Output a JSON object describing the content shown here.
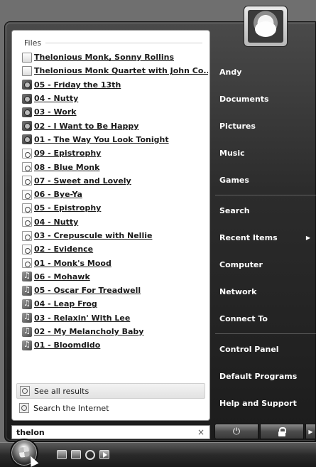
{
  "search": {
    "value": "thelon",
    "clear_glyph": "×"
  },
  "files": {
    "header": "Files",
    "items": [
      {
        "label": "Thelonious Monk, Sonny Rollins",
        "icon": "document-icon"
      },
      {
        "label": "Thelonious Monk Quartet with John Co...",
        "icon": "document-icon"
      },
      {
        "label": "05 - Friday the 13th",
        "icon": "album-art-icon"
      },
      {
        "label": "04 - Nutty",
        "icon": "album-art-icon"
      },
      {
        "label": "03 - Work",
        "icon": "album-art-icon"
      },
      {
        "label": "02 - I Want to Be Happy",
        "icon": "album-art-icon"
      },
      {
        "label": "01 - The Way You Look Tonight",
        "icon": "album-art-icon"
      },
      {
        "label": "09 - Epistrophy",
        "icon": "audio-file-icon"
      },
      {
        "label": "08 - Blue Monk",
        "icon": "audio-file-icon"
      },
      {
        "label": "07 - Sweet and Lovely",
        "icon": "audio-file-icon"
      },
      {
        "label": "06 - Bye-Ya",
        "icon": "audio-file-icon"
      },
      {
        "label": "05 - Epistrophy",
        "icon": "audio-file-icon"
      },
      {
        "label": "04 - Nutty",
        "icon": "audio-file-icon"
      },
      {
        "label": "03 - Crepuscule with Nellie",
        "icon": "audio-file-icon"
      },
      {
        "label": "02 - Evidence",
        "icon": "audio-file-icon"
      },
      {
        "label": "01 - Monk's Mood",
        "icon": "audio-file-icon"
      },
      {
        "label": "06 - Mohawk",
        "icon": "music-file-icon"
      },
      {
        "label": "05 - Oscar For Treadwell",
        "icon": "music-file-icon"
      },
      {
        "label": "04 - Leap Frog",
        "icon": "music-file-icon"
      },
      {
        "label": "03 - Relaxin' With Lee",
        "icon": "music-file-icon"
      },
      {
        "label": "02 - My Melancholy Baby",
        "icon": "music-file-icon"
      },
      {
        "label": "01 - Bloomdido",
        "icon": "music-file-icon"
      }
    ]
  },
  "bottom_links": {
    "see_all": "See all results",
    "search_internet": "Search the Internet"
  },
  "right_pane": {
    "user": "Andy",
    "documents": "Documents",
    "pictures": "Pictures",
    "music": "Music",
    "games": "Games",
    "search": "Search",
    "recent_items": "Recent Items",
    "computer": "Computer",
    "network": "Network",
    "connect_to": "Connect To",
    "control_panel": "Control Panel",
    "default_programs": "Default Programs",
    "help_and_support": "Help and Support"
  },
  "power": {
    "power_glyph": "⏻",
    "arrow_glyph": "▶"
  },
  "colors": {
    "menu_dark": "#2c2c2c",
    "left_pane": "#ffffff",
    "right_text": "#ffffff"
  }
}
